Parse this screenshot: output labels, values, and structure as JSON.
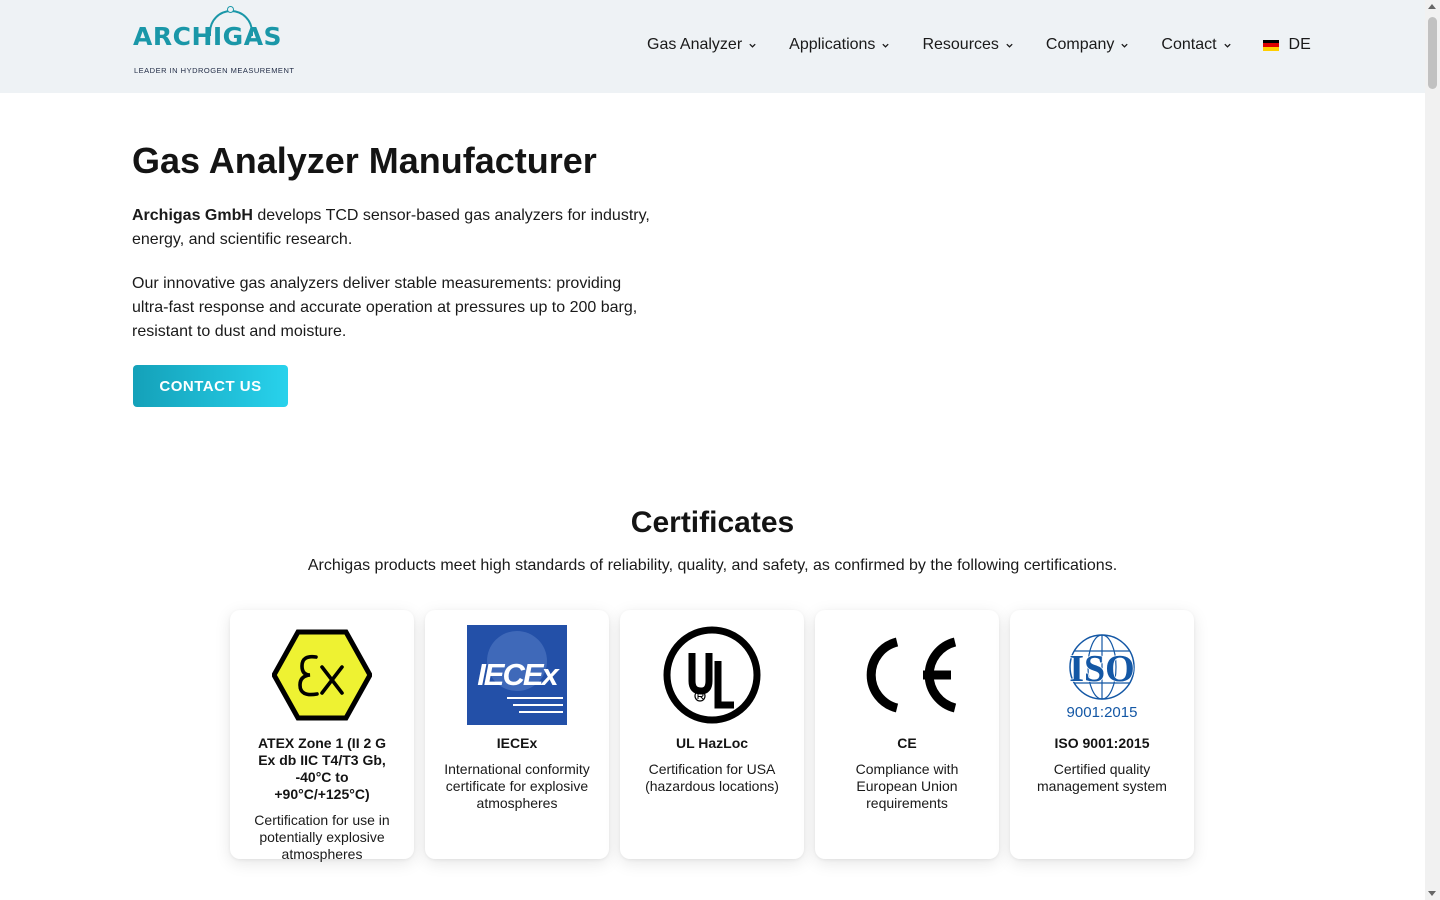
{
  "header": {
    "logo": {
      "wordmark": "ARCHIGAS",
      "tagline": "LEADER IN HYDROGEN MEASUREMENT"
    },
    "nav": [
      {
        "label": "Gas Analyzer"
      },
      {
        "label": "Applications"
      },
      {
        "label": "Resources"
      },
      {
        "label": "Company"
      },
      {
        "label": "Contact"
      }
    ],
    "language": {
      "label": "DE",
      "flag_icon": "germany-flag-icon"
    }
  },
  "hero": {
    "title": "Gas Analyzer Manufacturer",
    "intro_company": "Archigas GmbH",
    "intro_rest": " develops TCD sensor-based gas analyzers for industry, energy, and scientific research.",
    "paragraph2": "Our innovative gas analyzers deliver stable measurements: providing ultra-fast response and accurate operation at pressures up to 200 barg, resistant to dust and moisture.",
    "cta_label": "CONTACT US"
  },
  "certificates": {
    "title": "Certificates",
    "subtitle": "Archigas products meet high standards of reliability, quality, and safety, as confirmed by the following certifications.",
    "items": [
      {
        "icon": "atex-ex-icon",
        "name": "ATEX Zone 1 (II 2 G Ex db IIC T4/T3 Gb, -40°C to +90°C/+125°C)",
        "description": "Certification for use in potentially explosive atmospheres"
      },
      {
        "icon": "iecex-icon",
        "logo_text": "IECEx",
        "name": "IECEx",
        "description": "International conformity certificate for explosive atmospheres"
      },
      {
        "icon": "ul-icon",
        "name": "UL HazLoc",
        "description": "Certification for USA (hazardous locations)"
      },
      {
        "icon": "ce-mark-icon",
        "name": "CE",
        "description": "Compliance with European Union requirements"
      },
      {
        "icon": "iso-icon",
        "logo_text": "ISO",
        "logo_sub": "9001:2015",
        "name": "ISO 9001:2015",
        "description": "Certified quality management system"
      }
    ]
  },
  "colors": {
    "brand": "#1a97a8",
    "header_bg": "#eef2f5",
    "cta_gradient_start": "#14a1b9",
    "cta_gradient_end": "#28d2ec",
    "atex_yellow": "#eef232",
    "iecex_blue": "#2350a8",
    "iso_blue": "#1357a5"
  }
}
